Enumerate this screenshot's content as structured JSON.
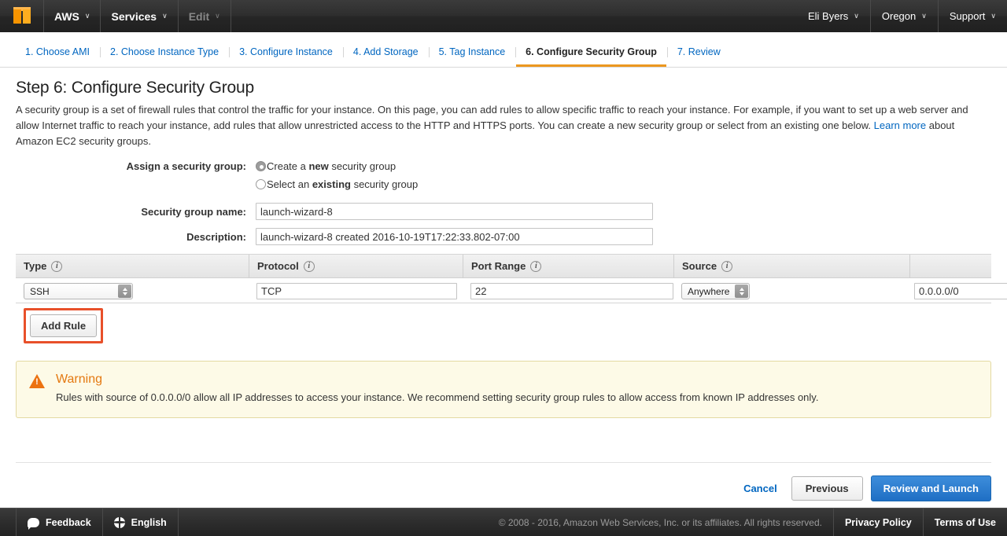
{
  "topnav": {
    "logo_icon": "aws-cube-logo",
    "left_items": [
      {
        "label": "AWS",
        "caret": "∨",
        "disabled": false
      },
      {
        "label": "Services",
        "caret": "∨",
        "disabled": false
      },
      {
        "label": "Edit",
        "caret": "∨",
        "disabled": true
      }
    ],
    "right_items": [
      {
        "label": "Eli Byers",
        "caret": "∨"
      },
      {
        "label": "Oregon",
        "caret": "∨"
      },
      {
        "label": "Support",
        "caret": "∨"
      }
    ]
  },
  "steps": [
    {
      "label": "1. Choose AMI",
      "active": false
    },
    {
      "label": "2. Choose Instance Type",
      "active": false
    },
    {
      "label": "3. Configure Instance",
      "active": false
    },
    {
      "label": "4. Add Storage",
      "active": false
    },
    {
      "label": "5. Tag Instance",
      "active": false
    },
    {
      "label": "6. Configure Security Group",
      "active": true
    },
    {
      "label": "7. Review",
      "active": false
    }
  ],
  "page": {
    "title": "Step 6: Configure Security Group",
    "desc_part1": "A security group is a set of firewall rules that control the traffic for your instance. On this page, you can add rules to allow specific traffic to reach your instance. For example, if you want to set up a web server and allow Internet traffic to reach your instance, add rules that allow unrestricted access to the HTTP and HTTPS ports. You can create a new security group or select from an existing one below. ",
    "learn_more": "Learn more",
    "desc_part2": " about Amazon EC2 security groups."
  },
  "form": {
    "assign_label": "Assign a security group:",
    "radio_new_prefix": "Create a ",
    "radio_new_bold": "new",
    "radio_new_suffix": " security group",
    "radio_new_selected": true,
    "radio_existing_prefix": "Select an ",
    "radio_existing_bold": "existing",
    "radio_existing_suffix": " security group",
    "radio_existing_selected": false,
    "name_label": "Security group name:",
    "name_value": "launch-wizard-8",
    "desc_label": "Description:",
    "desc_value": "launch-wizard-8 created 2016-10-19T17:22:33.802-07:00"
  },
  "table": {
    "headers": {
      "type": "Type",
      "protocol": "Protocol",
      "port_range": "Port Range",
      "source": "Source"
    },
    "info_icon": "i",
    "rows": [
      {
        "type": "SSH",
        "protocol": "TCP",
        "port_range": "22",
        "source_scope": "Anywhere",
        "source_cidr": "0.0.0.0/0",
        "delete_icon": "×"
      }
    ],
    "add_rule_label": "Add Rule",
    "add_rule_highlighted": true,
    "highlight_color": "#e8502a"
  },
  "warning": {
    "icon": "warning-triangle-icon",
    "bang": "!",
    "title": "Warning",
    "text": "Rules with source of 0.0.0.0/0 allow all IP addresses to access your instance. We recommend setting security group rules to allow access from known IP addresses only."
  },
  "actions": {
    "cancel": "Cancel",
    "previous": "Previous",
    "review_launch": "Review and Launch"
  },
  "bottombar": {
    "feedback": "Feedback",
    "language": "English",
    "copyright": "© 2008 - 2016, Amazon Web Services, Inc. or its affiliates. All rights reserved.",
    "privacy": "Privacy Policy",
    "terms": "Terms of Use"
  }
}
